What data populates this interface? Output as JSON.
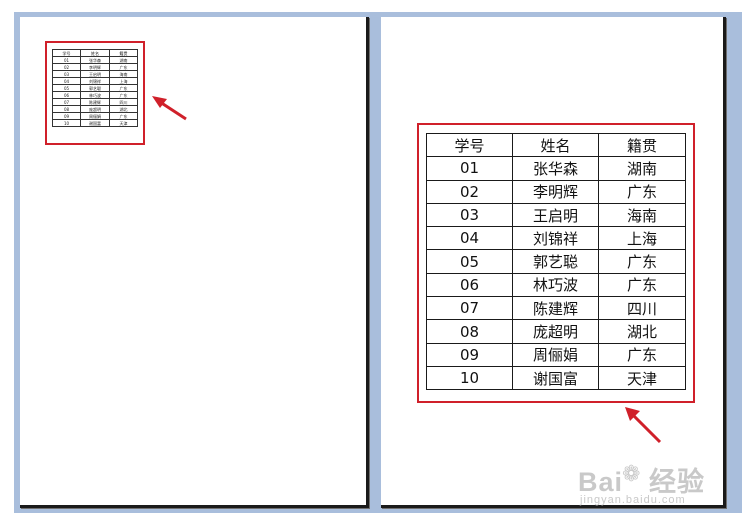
{
  "table": {
    "headers": [
      "学号",
      "姓名",
      "籍贯"
    ],
    "rows": [
      [
        "01",
        "张华森",
        "湖南"
      ],
      [
        "02",
        "李明辉",
        "广东"
      ],
      [
        "03",
        "王启明",
        "海南"
      ],
      [
        "04",
        "刘锦祥",
        "上海"
      ],
      [
        "05",
        "郭艺聪",
        "广东"
      ],
      [
        "06",
        "林巧波",
        "广东"
      ],
      [
        "07",
        "陈建辉",
        "四川"
      ],
      [
        "08",
        "庞超明",
        "湖北"
      ],
      [
        "09",
        "周俪娟",
        "广东"
      ],
      [
        "10",
        "谢国富",
        "天津"
      ]
    ]
  },
  "colors": {
    "highlight": "#d0202a",
    "frame": "#a9bedc"
  },
  "icons": [
    "arrow-icon",
    "paw-icon"
  ],
  "watermark": {
    "main_prefix": "Bai",
    "main_suffix": "经验",
    "sub": "jingyan.baidu.com"
  }
}
